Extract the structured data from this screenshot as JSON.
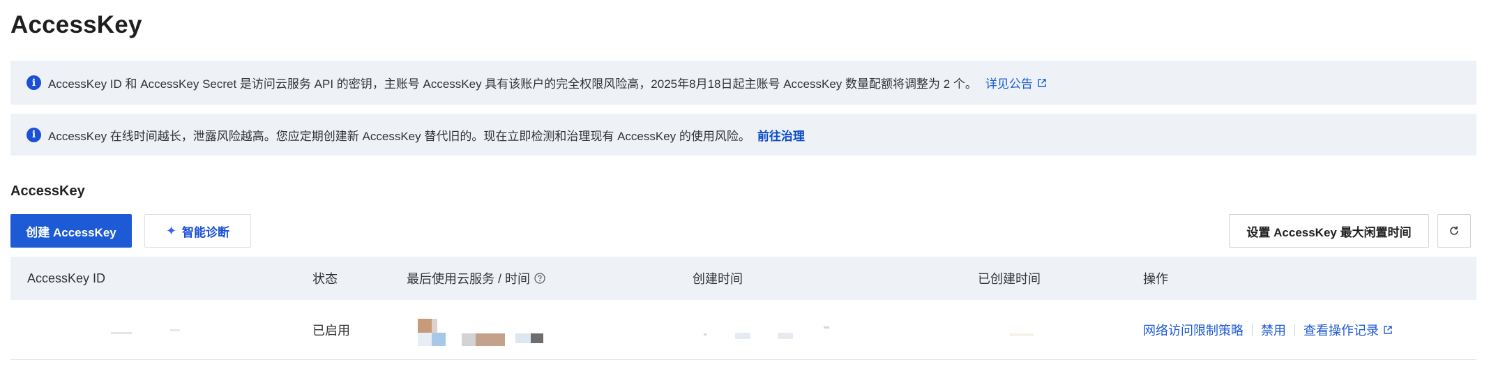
{
  "page": {
    "title": "AccessKey"
  },
  "notices": [
    {
      "text": "AccessKey ID 和 AccessKey Secret 是访问云服务 API 的密钥，主账号 AccessKey 具有该账户的完全权限风险高，2025年8月18日起主账号 AccessKey 数量配额将调整为 2 个。",
      "link": "详见公告",
      "icon": "info-icon",
      "link_icon": "external-link-icon"
    },
    {
      "text": "AccessKey 在线时间越长，泄露风险越高。您应定期创建新 AccessKey 替代旧的。现在立即检测和治理现有 AccessKey 的使用风险。",
      "link": "前往治理",
      "icon": "info-icon"
    }
  ],
  "section": {
    "title": "AccessKey"
  },
  "toolbar": {
    "create_label": "创建 AccessKey",
    "diagnose_label": "智能诊断",
    "idle_time_label": "设置 AccessKey 最大闲置时间",
    "refresh_icon": "refresh-icon"
  },
  "table": {
    "columns": [
      "AccessKey ID",
      "状态",
      "最后使用云服务 / 时间",
      "创建时间",
      "已创建时间",
      "操作"
    ],
    "rows": [
      {
        "status": "已启用",
        "actions": [
          "网络访问限制策略",
          "禁用",
          "查看操作记录"
        ]
      }
    ]
  },
  "colors": {
    "primary": "#1d5ad6",
    "notice_bg": "#eef2f7",
    "link": "#1a5bd6"
  }
}
